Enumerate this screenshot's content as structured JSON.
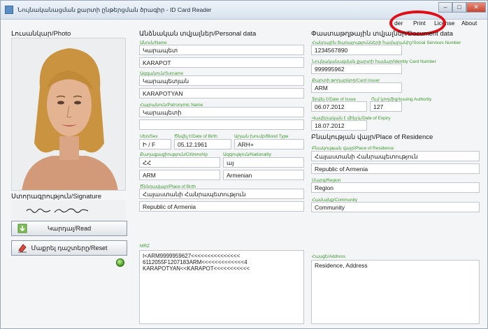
{
  "window": {
    "title": "Նույնականացման քարտի ընթերցման ծրագիր - ID Card Reader",
    "min": "–",
    "max": "□",
    "close": "✕"
  },
  "menu": {
    "reader": "der",
    "print": "Print",
    "license": "License",
    "about": "About"
  },
  "photo": {
    "title": "Լուսանկար/Photo"
  },
  "signature": {
    "label": "Ստորագրություն/Signature",
    "text": "ႵႮႵ ႦႰႰႦ"
  },
  "buttons": {
    "read": "Կարդալ/Read",
    "reset": "Մաքրել դաշտերը/Reset"
  },
  "personal": {
    "title": "Անձնական տվյալներ/Personal data",
    "name_label": "Անուն/Name",
    "name_arm": "Կարապետ",
    "name_lat": "KARAPOT",
    "surname_label": "Ազգանուն/Surname",
    "surname_arm": "Կարապետյան",
    "surname_lat": "KARAPOTYAN",
    "patronymic_label": "Հայրանուն/Patronymic Name",
    "patronymic_arm": "Կարապետի",
    "patronymic_lat": "",
    "sex_label": "Սեռ/Sex",
    "sex_value": "Ի / F",
    "dob_label": "Ծնվել է/Date of Birth",
    "dob_value": "05.12.1961",
    "blood_label": "Արյան խումբ/Blood Type",
    "blood_value": "ARH+",
    "citizenship_label": "Քաղաքացիություն/Citizenship",
    "citizenship_arm": "ՀՀ",
    "citizenship_lat": "ARM",
    "nationality_label": "Ազգություն/Nationality",
    "nationality_arm": "այ",
    "nationality_lat": "Armenian",
    "pob_label": "Ծննդավայր/Place of Birth",
    "pob_arm": "Հայաստանի Հանրապետություն",
    "pob_lat": "Republic of Armenia",
    "mrz_label": "MRZ",
    "mrz_text": "I<ARM9999959627<<<<<<<<<<<<<<<\n6112055F1207183ARM<<<<<<<<<<<<<4\nKARAPOTYAN<<KARAPOT<<<<<<<<<<<"
  },
  "document": {
    "title": "Փաստաթղթային տվյալներ/Document data",
    "ssn_label": "Հանրային ծառայությունների համարանիշ/Social Services Number",
    "ssn_value": "1234567890",
    "idnum_label": "Նույնականացման քարտի համար/Identity Card Number",
    "idnum_value": "999995962",
    "issuer_label": "Քարտի թողարկող/Card Issuer",
    "issuer_value": "ARM",
    "issue_label": "Տրվել է/Date of Issue",
    "issue_value": "06.07.2012",
    "authority_label": "Ում կողմից/Issuing Authority",
    "authority_value": "127",
    "expiry_label": "Վավերական է մինչև/Date of Expiry",
    "expiry_value": "18.07.2012"
  },
  "residence": {
    "title": "Բնակության վայր/Place of Residence",
    "place_label": "Բնակության վայր/Place of Residence",
    "place_arm": "Հայաստանի Հանրապետություն",
    "place_lat": "Republic of Armenia",
    "region_label": "Մարզ/Region",
    "region_value": "Region",
    "community_label": "Համայնք/Community",
    "community_value": "Community",
    "address_label": "Հասցե/Address",
    "address_value": "Residence, Address"
  },
  "colors": {
    "label_green": "#3a9a2e",
    "annotation_red": "#e00d14"
  }
}
